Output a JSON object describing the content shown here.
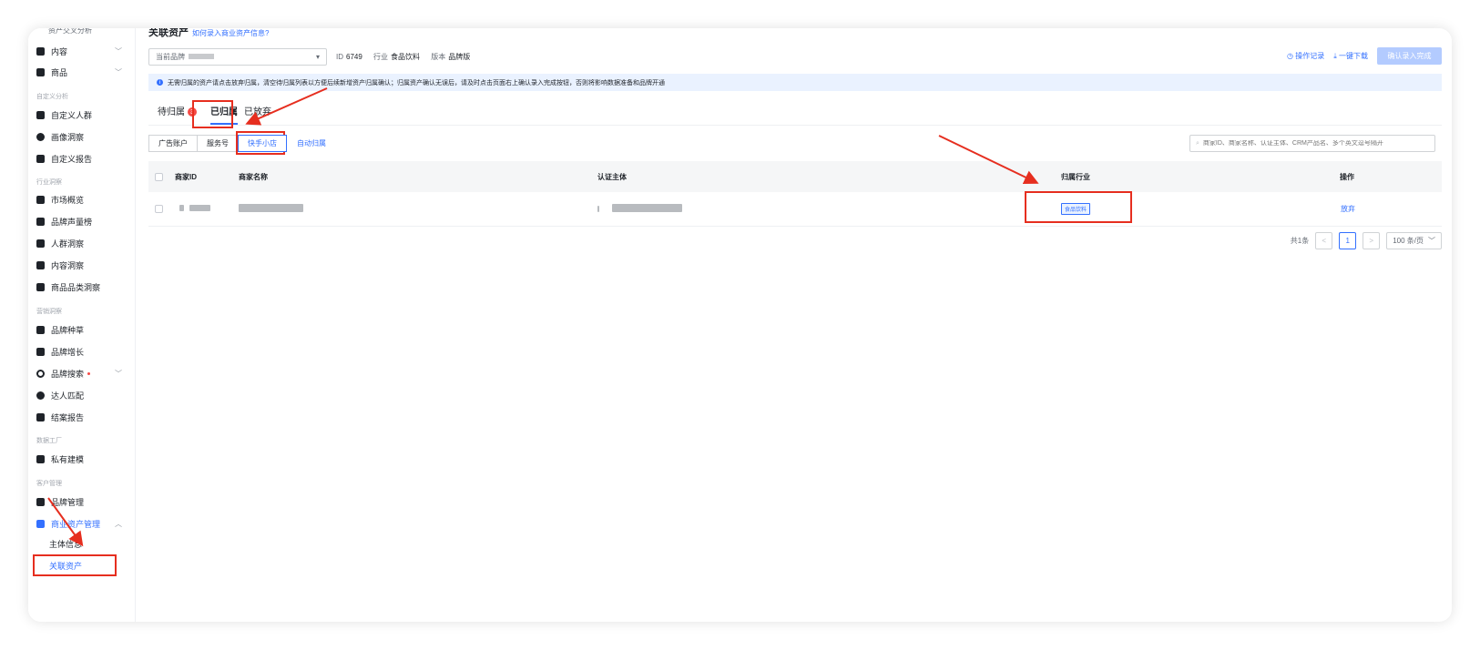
{
  "sidebar": {
    "top_partial": "资产交叉分析",
    "items": [
      {
        "label": "内容",
        "icon": "content-icon",
        "chevron": "﹀"
      },
      {
        "label": "商品",
        "icon": "product-icon",
        "chevron": "﹀"
      },
      {
        "group": "自定义分析"
      },
      {
        "label": "自定义人群",
        "icon": "custom-crowd-icon"
      },
      {
        "label": "画像洞察",
        "icon": "portrait-icon"
      },
      {
        "label": "自定义报告",
        "icon": "custom-report-icon"
      },
      {
        "group": "行业洞察"
      },
      {
        "label": "市场概览",
        "icon": "market-icon"
      },
      {
        "label": "品牌声量榜",
        "icon": "brand-volume-icon"
      },
      {
        "label": "人群洞察",
        "icon": "crowd-icon"
      },
      {
        "label": "内容洞察",
        "icon": "content-insight-icon"
      },
      {
        "label": "商品品类洞察",
        "icon": "category-icon"
      },
      {
        "group": "营销洞察"
      },
      {
        "label": "品牌种草",
        "icon": "seeding-icon"
      },
      {
        "label": "品牌增长",
        "icon": "growth-icon"
      },
      {
        "label": "品牌搜索",
        "icon": "search-icon",
        "chevron": "﹀",
        "dot": true
      },
      {
        "label": "达人匹配",
        "icon": "match-icon"
      },
      {
        "label": "结案报告",
        "icon": "report-icon"
      },
      {
        "group": "数据工厂"
      },
      {
        "label": "私有建模",
        "icon": "modeling-icon"
      },
      {
        "group": "客户管理"
      },
      {
        "label": "品牌管理",
        "icon": "brand-manage-icon"
      },
      {
        "label": "商业资产管理",
        "icon": "asset-manage-icon",
        "chevron": "︿",
        "active": true
      }
    ],
    "subitems": [
      "主体信息",
      "关联资产"
    ]
  },
  "page": {
    "title": "关联资产",
    "title_link": "如何录入商业资产信息?",
    "brand_label": "当前品牌",
    "id_label": "ID",
    "id_value": "6749",
    "industry_label": "行业",
    "industry_value": "食品饮料",
    "version_label": "版本",
    "version_value": "品牌版",
    "op_log": "操作记录",
    "download": "一键下载",
    "confirm": "确认录入完成",
    "notice": "无需归属的资产请点击放弃归属，清空待归属列表以方便后续新增资产归属确认；归属资产确认无误后，请及时点击页面右上确认录入完成按钮，否则将影响数据准备和品牌开通"
  },
  "tabs": [
    {
      "label": "待归属",
      "badge": "3"
    },
    {
      "label": "已归属",
      "active": true
    },
    {
      "label": "已放弃"
    }
  ],
  "segments": [
    "广告账户",
    "服务号",
    "快手小店"
  ],
  "segment_selected": "快手小店",
  "auto_assign": "自动归属",
  "search": {
    "placeholder": "商家ID、商家名称、认证主体、CRM产品名、多个英文逗号隔开"
  },
  "table": {
    "columns": [
      "商家ID",
      "商家名称",
      "认证主体",
      "归属行业",
      "操作"
    ],
    "rows": [
      {
        "industry": "食品饮料",
        "action": "放弃"
      }
    ]
  },
  "pager": {
    "total": "共1条",
    "prev": "<",
    "page": "1",
    "next": ">",
    "size": "100 条/页"
  },
  "colors": {
    "accent": "#3370ff",
    "annotation": "#e62e1f"
  }
}
